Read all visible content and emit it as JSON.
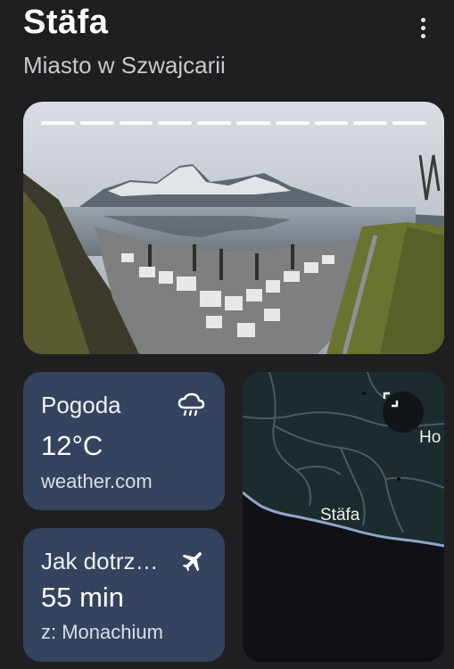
{
  "header": {
    "title": "Stäfa",
    "subtitle": "Miasto w Szwajcarii"
  },
  "photo": {
    "story_segments": 10
  },
  "weather_card": {
    "label": "Pogoda",
    "temperature": "12°C",
    "source": "weather.com",
    "icon": "cloud-rain-icon"
  },
  "travel_card": {
    "label": "Jak dotrz…",
    "duration": "55 min",
    "origin": "z: Monachium",
    "icon": "airplane-icon"
  },
  "map": {
    "place_label": "Stäfa",
    "edge_label": "Ho",
    "icon": "expand-icon"
  },
  "colors": {
    "background": "#1f1f22",
    "card": "#34445e",
    "map_land": "#1c2b2d",
    "map_water": "#0f1116"
  }
}
